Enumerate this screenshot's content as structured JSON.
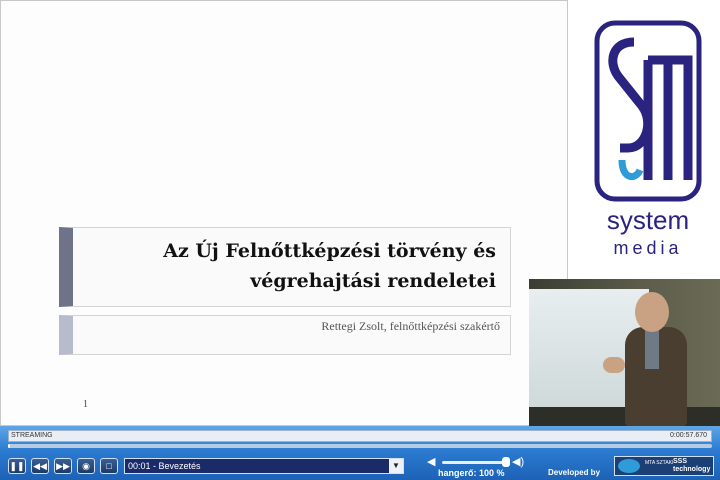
{
  "slide": {
    "title_line1": "Az Új Felnőttképzési törvény és",
    "title_line2": "végrehajtási rendeletei",
    "subtitle": "Rettegi Zsolt, felnőttképzési szakértő",
    "page_number": "1"
  },
  "logo": {
    "word1": "system",
    "word2": "media",
    "color": "#2a2380"
  },
  "player": {
    "status_label": "STREAMING",
    "time": "0:00:57.670",
    "progress": 0.002,
    "buttons": {
      "pause": "pause-icon",
      "rewind": "rewind-icon",
      "forward": "fast-forward-icon",
      "view": "eye-icon",
      "fullscreen": "fullscreen-icon"
    },
    "chapter": "00:01 - Bevezetés",
    "volume_label": "hangerő: 100 %",
    "volume_level": 1.0,
    "developed_by": "Developed by",
    "dev_logo": {
      "left": "MTA SZTAKI",
      "right_top": "SSS",
      "right_bottom": "technology"
    }
  }
}
